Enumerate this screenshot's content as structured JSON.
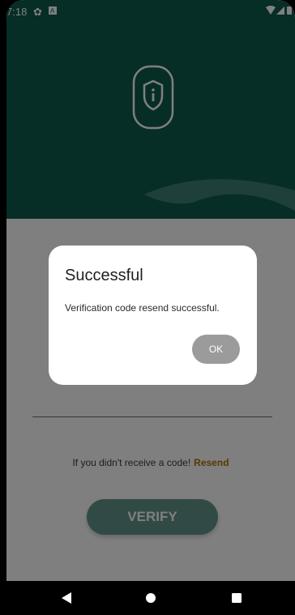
{
  "status_bar": {
    "time": "7:18",
    "icons": [
      "gear-icon",
      "a-icon",
      "wifi-icon",
      "signal-icon",
      "battery-icon"
    ]
  },
  "resend": {
    "prompt": "If you didn't receive a code!",
    "link": "Resend"
  },
  "verify_button": {
    "label": "VERIFY"
  },
  "dialog": {
    "title": "Successful",
    "message": "Verification code resend successful.",
    "ok_label": "OK"
  },
  "nav_bar": {
    "buttons": [
      "back-icon",
      "home-icon",
      "recents-icon"
    ]
  },
  "colors": {
    "brand": "#0f5b4f",
    "resend_link": "#b07000",
    "ok_button": "#9b9b9b"
  }
}
